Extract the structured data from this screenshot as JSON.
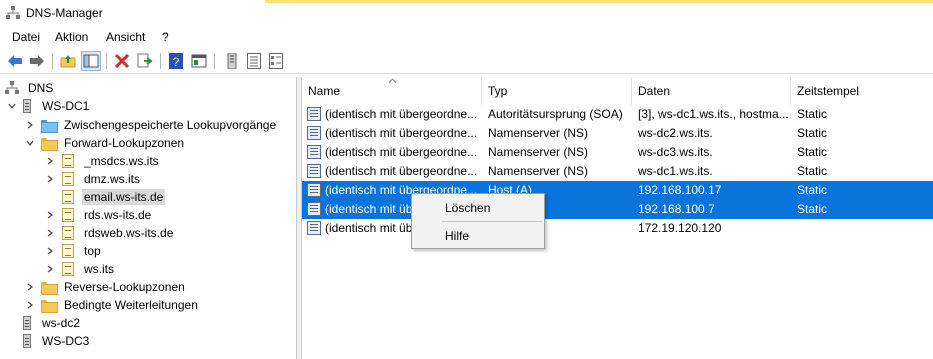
{
  "window": {
    "title": "DNS-Manager"
  },
  "menu": [
    "Datei",
    "Aktion",
    "Ansicht",
    "?"
  ],
  "toolbar": {
    "icons": [
      "back-arrow-icon",
      "forward-arrow-icon",
      "up-folder-icon",
      "show-hide-console-tree-icon",
      "delete-icon",
      "export-list-icon",
      "help-icon",
      "show-hide-action-pane-icon",
      "server-icon",
      "list-icon",
      "details-icon"
    ],
    "colors": {
      "back": "#2f7bd6",
      "forward": "#6a6a6a",
      "delete": "#d42a2a",
      "help": "#2a4fb8"
    }
  },
  "tree": {
    "root": "DNS",
    "server": "WS-DC1",
    "cached": "Zwischengespeicherte Lookupvorgänge",
    "forward": "Forward-Lookupzonen",
    "zones": [
      "_msdcs.ws.its",
      "dmz.ws.its",
      "email.ws-its.de",
      "rds.ws-its.de",
      "rdsweb.ws-its.de",
      "top",
      "ws.its"
    ],
    "reverse": "Reverse-Lookupzonen",
    "conditional": "Bedingte Weiterleitungen",
    "servers": [
      "ws-dc2",
      "WS-DC3"
    ]
  },
  "list": {
    "columns": [
      "Name",
      "Typ",
      "Daten",
      "Zeitstempel"
    ],
    "rows": [
      {
        "name": "(identisch mit übergeordne...",
        "type": "Autoritätsursprung (SOA)",
        "data": "[3], ws-dc1.ws.its., hostma...",
        "timestamp": "Static"
      },
      {
        "name": "(identisch mit übergeordne...",
        "type": "Namenserver (NS)",
        "data": "ws-dc2.ws.its.",
        "timestamp": "Static"
      },
      {
        "name": "(identisch mit übergeordne...",
        "type": "Namenserver (NS)",
        "data": "ws-dc3.ws.its.",
        "timestamp": "Static"
      },
      {
        "name": "(identisch mit übergeordne...",
        "type": "Namenserver (NS)",
        "data": "ws-dc1.ws.its.",
        "timestamp": "Static"
      },
      {
        "name": "(identisch mit übergeordne...",
        "type": "Host (A)",
        "data": "192.168.100.17",
        "timestamp": "Static"
      },
      {
        "name": "(identisch mit übergeordne...",
        "type": "",
        "data": "192.168.100.7",
        "timestamp": "Static"
      },
      {
        "name": "(identisch mit übergeordne...",
        "type": "",
        "data": "172.19.120.120",
        "timestamp": ""
      }
    ]
  },
  "context_menu": {
    "items": [
      "Löschen",
      "Hilfe"
    ]
  },
  "colors": {
    "selection": "#0a74da",
    "selected_tree": "#d9d9d9"
  }
}
